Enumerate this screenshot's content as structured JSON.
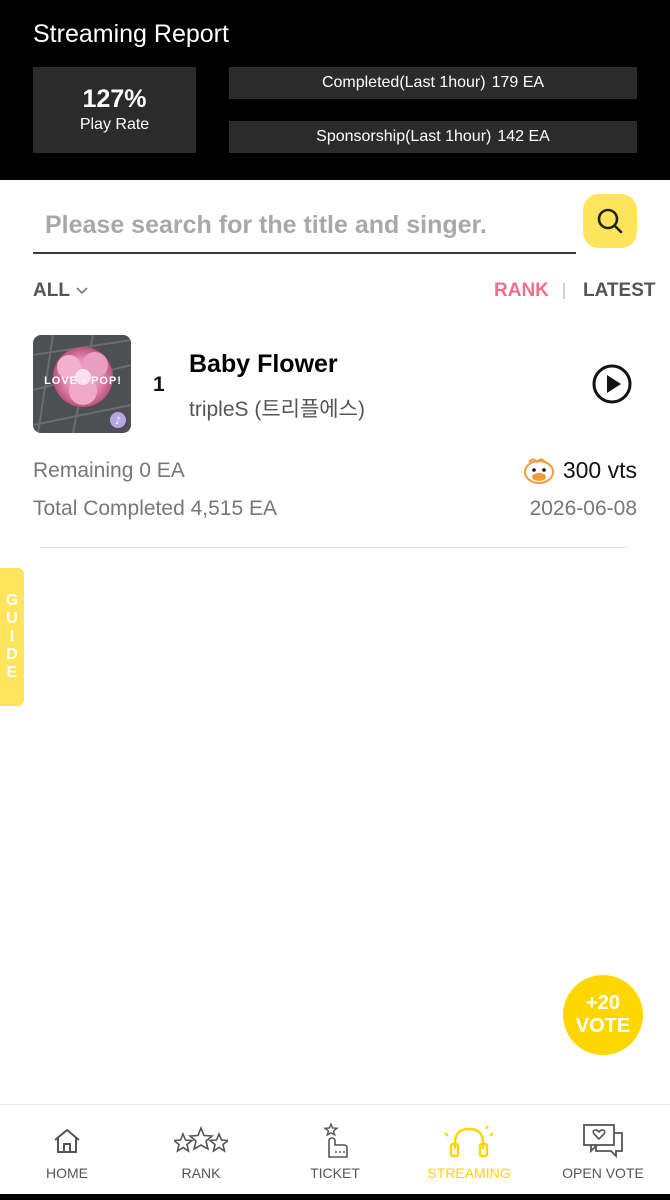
{
  "header": {
    "title": "Streaming Report",
    "play_rate_value": "127%",
    "play_rate_label": "Play Rate",
    "completed_label": "Completed(Last 1hour)",
    "completed_value": "179 EA",
    "sponsorship_label": "Sponsorship(Last 1hour)",
    "sponsorship_value": "142 EA"
  },
  "search": {
    "placeholder": "Please search for the title and singer.",
    "icon": "search-icon"
  },
  "filters": {
    "category": "ALL",
    "sort_rank": "RANK",
    "sort_latest": "LATEST",
    "active_sort": "RANK"
  },
  "songs": [
    {
      "rank": "1",
      "title": "Baby Flower",
      "artist": "tripleS (트리플에스)",
      "album_text": "LOVE ◦ POP!",
      "remaining": "Remaining 0 EA",
      "total_completed": "Total Completed 4,515 EA",
      "votes": "300 vts",
      "date": "2026-06-08"
    }
  ],
  "guide_tab": [
    "G",
    "U",
    "I",
    "D",
    "E"
  ],
  "vote_fab": {
    "line1": "+20",
    "line2": "VOTE"
  },
  "nav": {
    "items": [
      {
        "label": "HOME",
        "icon": "home-icon"
      },
      {
        "label": "RANK",
        "icon": "stars-icon"
      },
      {
        "label": "TICKET",
        "icon": "ticket-icon"
      },
      {
        "label": "STREAMING",
        "icon": "headphones-icon"
      },
      {
        "label": "OPEN VOTE",
        "icon": "chat-vote-icon"
      }
    ],
    "active": "STREAMING"
  },
  "colors": {
    "accent_yellow": "#ffe45c",
    "fab_yellow": "#ffd700",
    "rank_pink": "#f26f8c",
    "header_bg": "#000000",
    "header_box": "#2b2b2b"
  }
}
